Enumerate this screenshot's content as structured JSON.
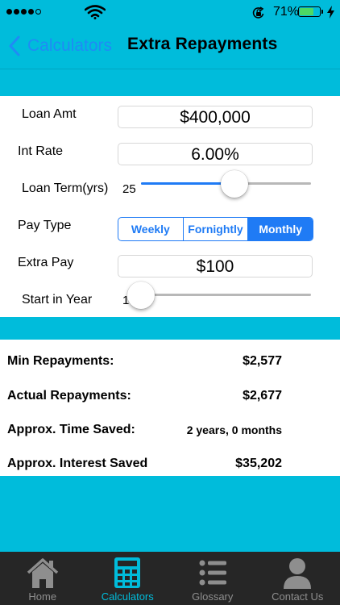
{
  "status_bar": {
    "time": "",
    "battery_percent": "71%"
  },
  "nav": {
    "back_label": "Calculators",
    "title": "Extra Repayments"
  },
  "form": {
    "loan_amount": {
      "label": "Loan Amt",
      "value": "$400,000"
    },
    "interest_rate": {
      "label": "Int Rate",
      "value": "6.00%"
    },
    "loan_term": {
      "label": "Loan Term(yrs)",
      "value": "25",
      "slider_fraction": 0.55
    },
    "pay_type": {
      "label": "Pay Type",
      "options": [
        "Weekly",
        "Fornightly",
        "Monthly"
      ],
      "selected": "Monthly"
    },
    "extra_pay": {
      "label": "Extra Pay",
      "value": "$100"
    },
    "start_year": {
      "label": "Start in Year",
      "value": "1",
      "slider_fraction": 0.0
    }
  },
  "results": {
    "min_repayments": {
      "label": "Min Repayments:",
      "value": "$2,577"
    },
    "actual_repayments": {
      "label": "Actual Repayments:",
      "value": "$2,677"
    },
    "time_saved": {
      "label": "Approx. Time Saved:",
      "value": "2 years, 0 months"
    },
    "interest_saved": {
      "label": "Approx. Interest Saved",
      "value": "$35,202"
    }
  },
  "tabs": [
    {
      "label": "Home",
      "icon": "house-icon",
      "active": false
    },
    {
      "label": "Calculators",
      "icon": "calculator-icon",
      "active": true
    },
    {
      "label": "Glossary",
      "icon": "list-icon",
      "active": false
    },
    {
      "label": "Contact Us",
      "icon": "person-icon",
      "active": false
    }
  ],
  "colors": {
    "accent_cyan": "#00bcdb",
    "ios_blue": "#1f7bf5",
    "battery_green": "#4cd964",
    "tabbar_bg": "#262626"
  }
}
